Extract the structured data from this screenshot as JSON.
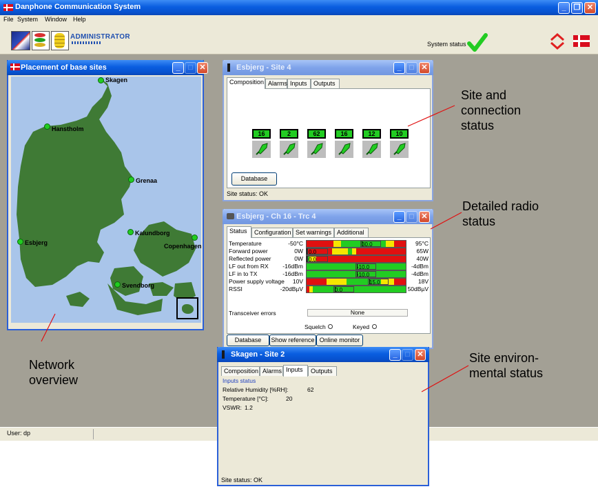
{
  "app": {
    "title": "Danphone Communication System",
    "menu": [
      "File",
      "System",
      "Window",
      "Help"
    ],
    "role_label": "ADMINISTRATOR",
    "system_status_label": "System status",
    "statusbar_user": "User: dp",
    "icons": [
      "map-icon",
      "database-stack-icon",
      "coins-icon",
      "check-icon",
      "up-down-arrows-icon",
      "danish-flag-icon"
    ]
  },
  "map_window": {
    "title": "Placement of base sites",
    "sites": [
      "Skagen",
      "Hanstholm",
      "Grenaa",
      "Kalundborg",
      "Copenhagen",
      "Esbjerg",
      "Svendborg"
    ]
  },
  "site_window": {
    "title": "Esbjerg - Site 4",
    "tabs": [
      "Composition",
      "Alarms",
      "Inputs",
      "Outputs"
    ],
    "channels": [
      "16",
      "2",
      "62",
      "16",
      "12",
      "10"
    ],
    "database_button": "Database",
    "status": "Site status: OK"
  },
  "radio_window": {
    "title": "Esbjerg - Ch 16 - Trc 4",
    "tabs": [
      "Status",
      "Configuration",
      "Set warnings",
      "Additional"
    ],
    "rows": [
      {
        "label": "Temperature",
        "min": "-50°C",
        "value": "30.0",
        "max": "95°C",
        "fill": 0.55
      },
      {
        "label": "Forward power",
        "min": "0W",
        "value": "0.0",
        "max": "65W",
        "fill": 0.0
      },
      {
        "label": "Reflected power",
        "min": "0W",
        "value": "0.0",
        "max": "40W",
        "fill": 0.0
      },
      {
        "label": "LF out from RX",
        "min": "-16dBm",
        "value": "-10.0",
        "max": "-4dBm",
        "fill": 0.5
      },
      {
        "label": "LF in to TX",
        "min": "-16dBm",
        "value": "-10.0",
        "max": "-4dBm",
        "fill": 0.5
      },
      {
        "label": "Power supply voltage",
        "min": "10V",
        "value": "15.0",
        "max": "18V",
        "fill": 0.62
      },
      {
        "label": "RSSI",
        "min": "-20dBµV",
        "value": "0.0",
        "max": "50dBµV",
        "fill": 0.28
      }
    ],
    "transceiver_errors_label": "Transceiver errors",
    "transceiver_errors_value": "None",
    "squelch_label": "Squelch",
    "keyed_label": "Keyed",
    "buttons": [
      "Database",
      "Show reference",
      "Online monitor"
    ]
  },
  "env_window": {
    "title": "Skagen - Site 2",
    "tabs": [
      "Composition",
      "Alarms",
      "Inputs",
      "Outputs"
    ],
    "section": "Inputs status",
    "rows": [
      {
        "label": "Relative Humidity [%RH]:",
        "value": "62"
      },
      {
        "label": "Temperature [°C]:",
        "value": "20"
      },
      {
        "label": "VSWR:",
        "value": "1.2"
      }
    ],
    "status": "Site status: OK"
  },
  "annotations": {
    "site": [
      "Site and",
      "connection",
      "status"
    ],
    "radio": [
      "Detailed radio",
      "status"
    ],
    "env": [
      "Site environ-",
      "mental status"
    ],
    "network": [
      "Network",
      "overview"
    ]
  },
  "colors": {
    "titlebar": "#0a5ee0",
    "green": "#22cc22",
    "red": "#e01010",
    "yellow": "#f6e600",
    "desktop": "#a3a095"
  }
}
